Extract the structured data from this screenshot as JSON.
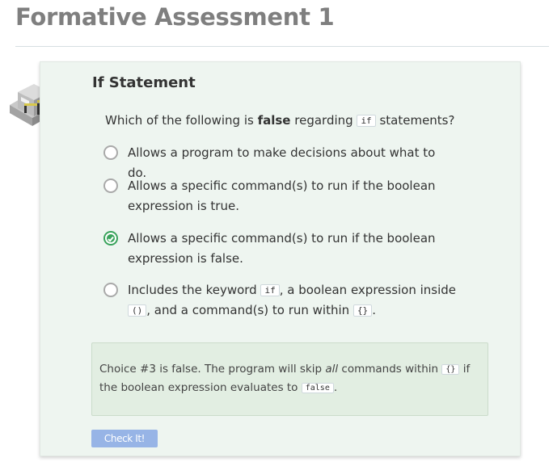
{
  "page": {
    "title": "Formative Assessment 1"
  },
  "card": {
    "title": "If Statement",
    "question": {
      "before": "Which of the following is ",
      "bold": "false",
      "middle": " regarding ",
      "code": "if",
      "after": " statements?"
    },
    "choices": [
      {
        "text": "Allows a program to make decisions about what to do.",
        "selected": false
      },
      {
        "text": "Allows a specific command(s) to run if the boolean expression is true.",
        "selected": false
      },
      {
        "text": "Allows a specific command(s) to run if the boolean expression is false.",
        "selected": true
      },
      {
        "text_1": "Includes the keyword ",
        "code_1": "if",
        "text_2": ", a boolean expression inside ",
        "code_2": "()",
        "text_3": ", and a command(s) to run within ",
        "code_3": "{}",
        "text_4": ".",
        "selected": false
      }
    ],
    "feedback": {
      "text_1": "Choice #3 is false. The program will skip ",
      "italic": "all",
      "text_2": " commands within ",
      "code_1": "{}",
      "text_3": " if the boolean expression evaluates to ",
      "code_2": "false",
      "text_4": "."
    },
    "check_button_label": "Check It!",
    "selected_color": "#3aa35c"
  },
  "icons": {
    "assessment": "cube-icon"
  }
}
